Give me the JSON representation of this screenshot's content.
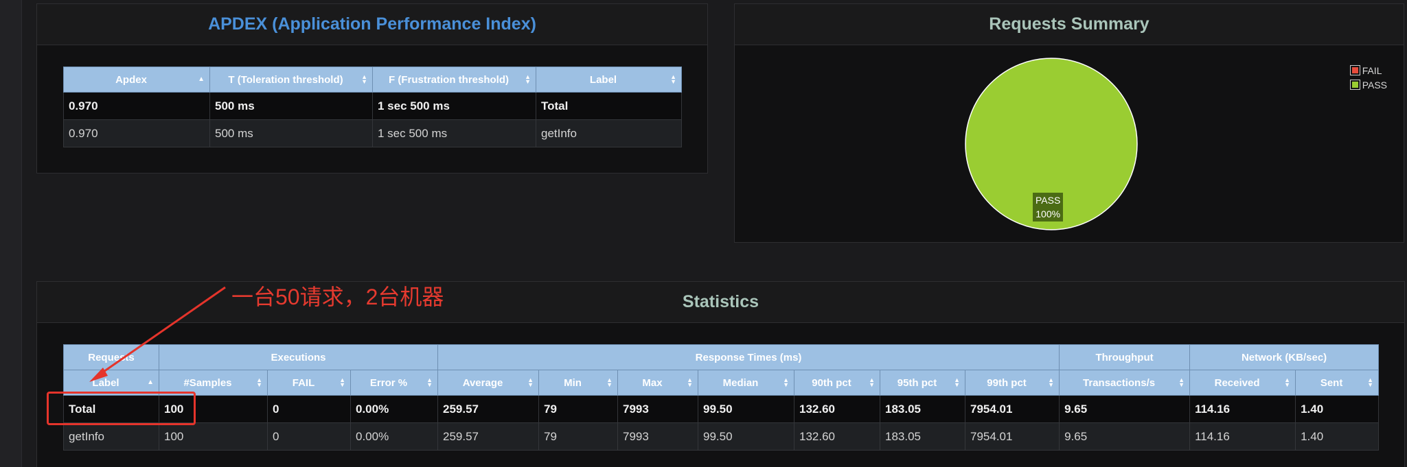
{
  "apdex": {
    "title": "APDEX (Application Performance Index)",
    "headers": [
      "Apdex",
      "T (Toleration threshold)",
      "F (Frustration threshold)",
      "Label"
    ],
    "rows": [
      [
        "0.970",
        "500 ms",
        "1 sec 500 ms",
        "Total"
      ],
      [
        "0.970",
        "500 ms",
        "1 sec 500 ms",
        "getInfo"
      ]
    ]
  },
  "summary": {
    "title": "Requests Summary",
    "legend": [
      "FAIL",
      "PASS"
    ],
    "pie_label_name": "PASS",
    "pie_label_pct": "100%"
  },
  "chart_data": {
    "type": "pie",
    "title": "Requests Summary",
    "categories": [
      "FAIL",
      "PASS"
    ],
    "values": [
      0,
      100
    ],
    "colors": [
      "#e74c3c",
      "#9acd32"
    ],
    "legend_position": "top-right"
  },
  "statistics": {
    "title": "Statistics",
    "groups": [
      "Requests",
      "Executions",
      "Response Times (ms)",
      "Throughput",
      "Network (KB/sec)"
    ],
    "headers": [
      "Label",
      "#Samples",
      "FAIL",
      "Error %",
      "Average",
      "Min",
      "Max",
      "Median",
      "90th pct",
      "95th pct",
      "99th pct",
      "Transactions/s",
      "Received",
      "Sent"
    ],
    "rows": [
      [
        "Total",
        "100",
        "0",
        "0.00%",
        "259.57",
        "79",
        "7993",
        "99.50",
        "132.60",
        "183.05",
        "7954.01",
        "9.65",
        "114.16",
        "1.40"
      ],
      [
        "getInfo",
        "100",
        "0",
        "0.00%",
        "259.57",
        "79",
        "7993",
        "99.50",
        "132.60",
        "183.05",
        "7954.01",
        "9.65",
        "114.16",
        "1.40"
      ]
    ]
  },
  "annotation": {
    "text": "一台50请求，2台机器",
    "color": "#e53a2f"
  },
  "colors": {
    "header_bg": "#9dc0e3",
    "apdex_title": "#4a90d9",
    "panel_title": "#aac5ba",
    "pass": "#9acd32",
    "fail": "#e74c3c"
  }
}
